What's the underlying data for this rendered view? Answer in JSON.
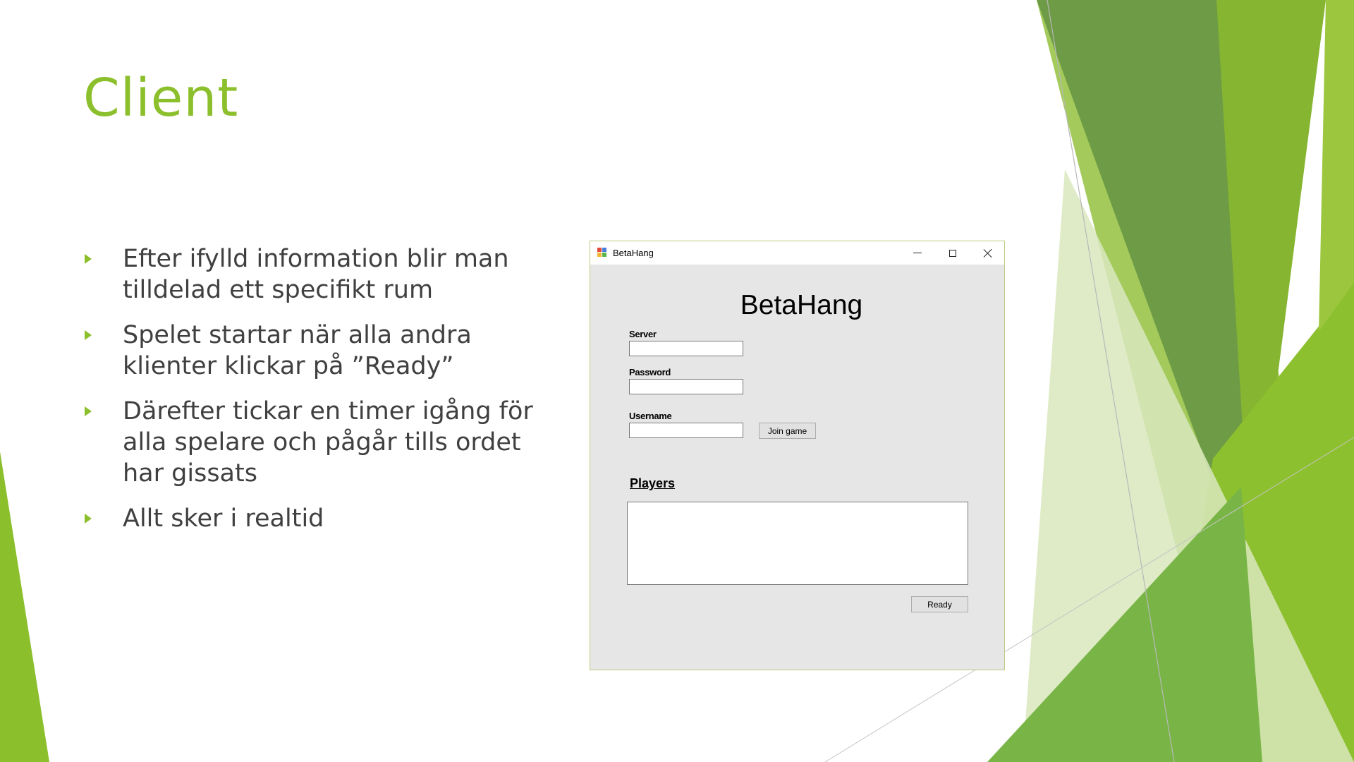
{
  "slide": {
    "title": "Client",
    "bullets": [
      "Efter ifylld information blir man tilldelad ett specifikt rum",
      "Spelet startar när alla andra klienter klickar på ”Ready”",
      "Därefter tickar en timer igång för alla spelare och pågår tills ordet har gissats",
      "Allt sker i realtid"
    ]
  },
  "window": {
    "title": "BetaHang",
    "heading": "BetaHang",
    "server_label": "Server",
    "server_value": "",
    "password_label": "Password",
    "password_value": "",
    "username_label": "Username",
    "username_value": "",
    "join_button": "Join game",
    "players_label": "Players",
    "players": [],
    "ready_button": "Ready"
  },
  "colors": {
    "title_green": "#8cbf2c",
    "body_text": "#404040",
    "window_bg": "#e6e6e6",
    "window_border": "#b9cc80"
  }
}
